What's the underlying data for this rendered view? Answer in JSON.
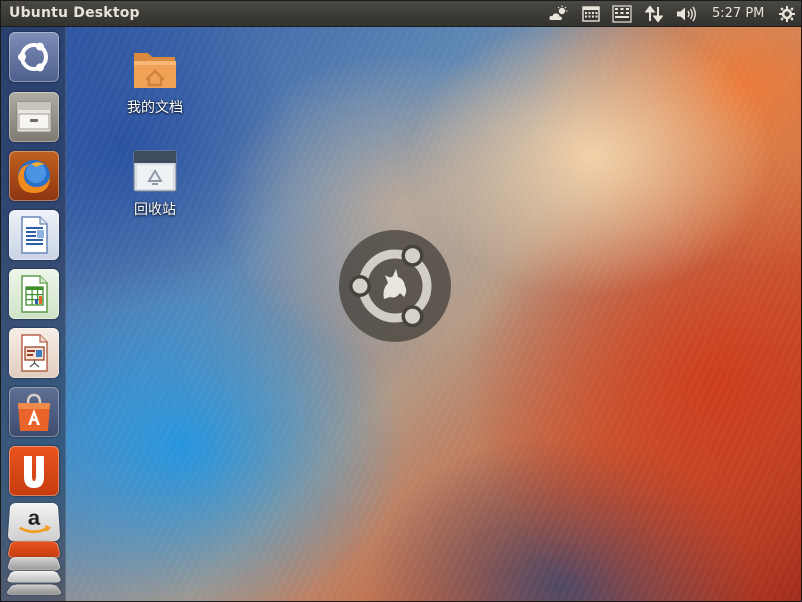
{
  "panel": {
    "title": "Ubuntu Desktop",
    "clock": "5:27 PM"
  },
  "launcher": {
    "items": [
      {
        "icon": "dash-home-icon"
      },
      {
        "icon": "file-manager-icon"
      },
      {
        "icon": "firefox-icon"
      },
      {
        "icon": "libreoffice-writer-icon"
      },
      {
        "icon": "libreoffice-calc-icon"
      },
      {
        "icon": "libreoffice-impress-icon"
      },
      {
        "icon": "software-center-icon"
      },
      {
        "icon": "ubuntu-one-icon"
      },
      {
        "icon": "amazon-icon"
      }
    ]
  },
  "desktop": {
    "icons": [
      {
        "label": "我的文档",
        "icon": "folder-icon"
      },
      {
        "label": "回收站",
        "icon": "trash-icon"
      }
    ]
  },
  "colors": {
    "panel": "#3c3b37",
    "accent": "#dd4814"
  }
}
